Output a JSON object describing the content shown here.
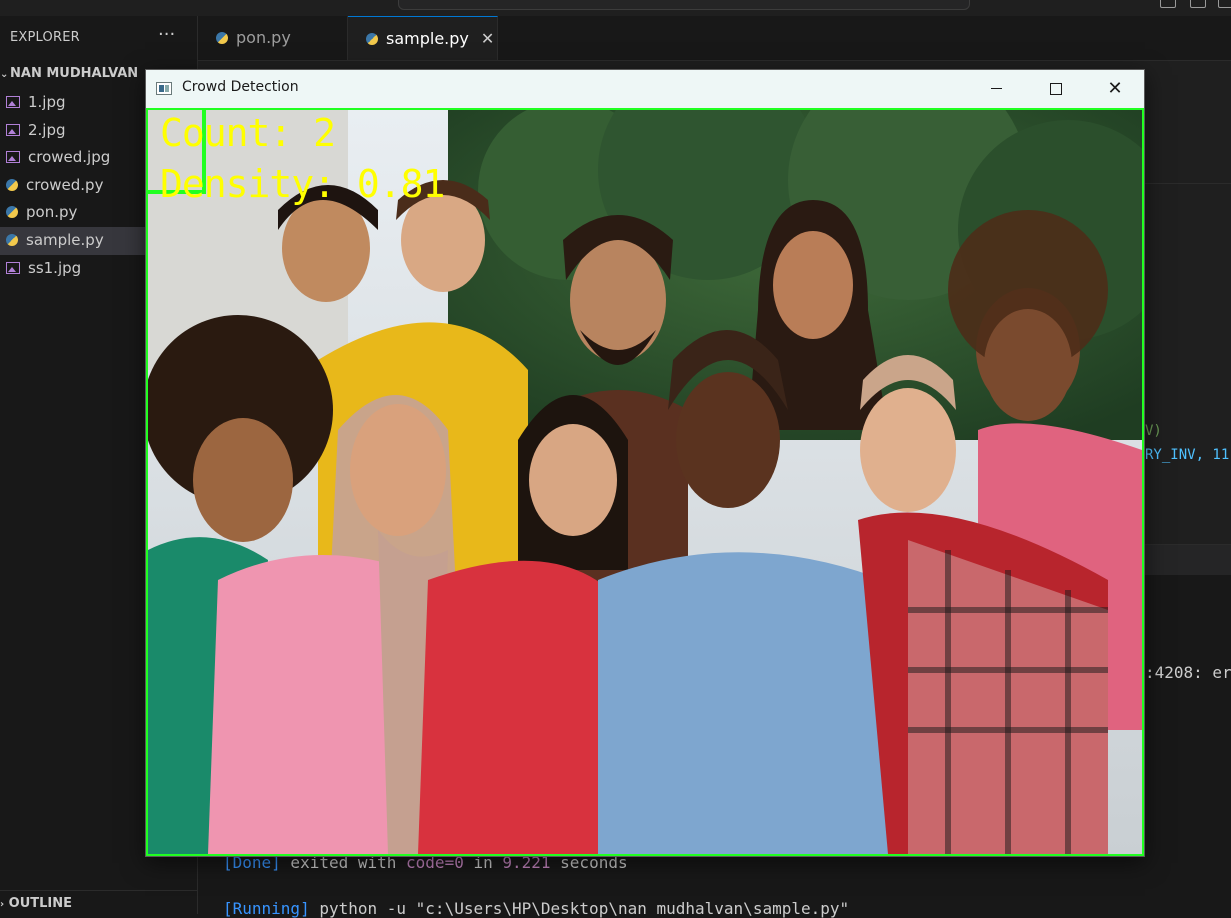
{
  "explorer": {
    "title": "EXPLORER",
    "more": "···",
    "folder": "NAN MUDHALVAN",
    "files": [
      {
        "name": "1.jpg",
        "icon": "image-file-icon"
      },
      {
        "name": "2.jpg",
        "icon": "image-file-icon"
      },
      {
        "name": "crowed.jpg",
        "icon": "image-file-icon"
      },
      {
        "name": "crowed.py",
        "icon": "python-file-icon"
      },
      {
        "name": "pon.py",
        "icon": "python-file-icon"
      },
      {
        "name": "sample.py",
        "icon": "python-file-icon"
      },
      {
        "name": "ss1.jpg",
        "icon": "image-file-icon"
      }
    ],
    "outline": "OUTLINE"
  },
  "tabs": [
    {
      "label": "pon.py"
    },
    {
      "label": "sample.py",
      "close": "✕"
    }
  ],
  "editor": {
    "code_right_1": "V)",
    "code_right_2": "RY_INV, 11"
  },
  "terminal": {
    "partial_error": ":4208: er",
    "done_prefix": "[Done]",
    "done_text": " exited with ",
    "done_code": "code=0",
    "done_in": " in ",
    "done_time": "9.221",
    "done_suffix": " seconds",
    "running_prefix": "[Running]",
    "running_cmd": " python -u \"c:\\Users\\HP\\Desktop\\nan mudhalvan\\sample.py\""
  },
  "window": {
    "title": "Crowd Detection",
    "close": "✕",
    "count_text": "Count: 2",
    "density_text": "Density: 0.81",
    "photo_description_colors": {
      "overlay_text": "#ffff00",
      "box": "#21ff21"
    }
  }
}
